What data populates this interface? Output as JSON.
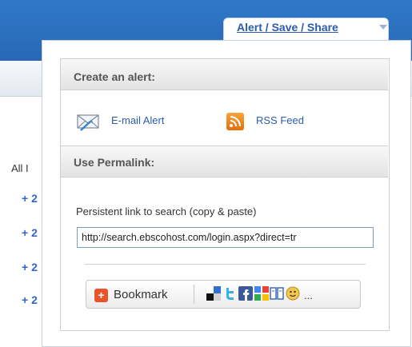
{
  "background": {
    "left_text": "All I",
    "plus": "+ 2"
  },
  "tab": {
    "label": "Alert / Save / Share"
  },
  "alert_section": {
    "title": "Create an alert:",
    "email_label": "E-mail Alert",
    "rss_label": "RSS Feed"
  },
  "permalink_section": {
    "title": "Use Permalink:",
    "label": "Persistent link to search (copy & paste)",
    "url": "http://search.ebscohost.com/login.aspx?direct=tr"
  },
  "share": {
    "bookmark_label": "Bookmark",
    "more": "..."
  },
  "colors": {
    "header_blue": "#2f78c8",
    "link_blue": "#2a5db0",
    "rss_orange": "#f29220",
    "bookmark_red": "#e8532a"
  },
  "icons": [
    "email-icon",
    "rss-icon",
    "bookmark-plus-icon",
    "delicious-icon",
    "twitter-icon",
    "facebook-icon",
    "google-icon",
    "digg-icon",
    "smiley-icon"
  ]
}
